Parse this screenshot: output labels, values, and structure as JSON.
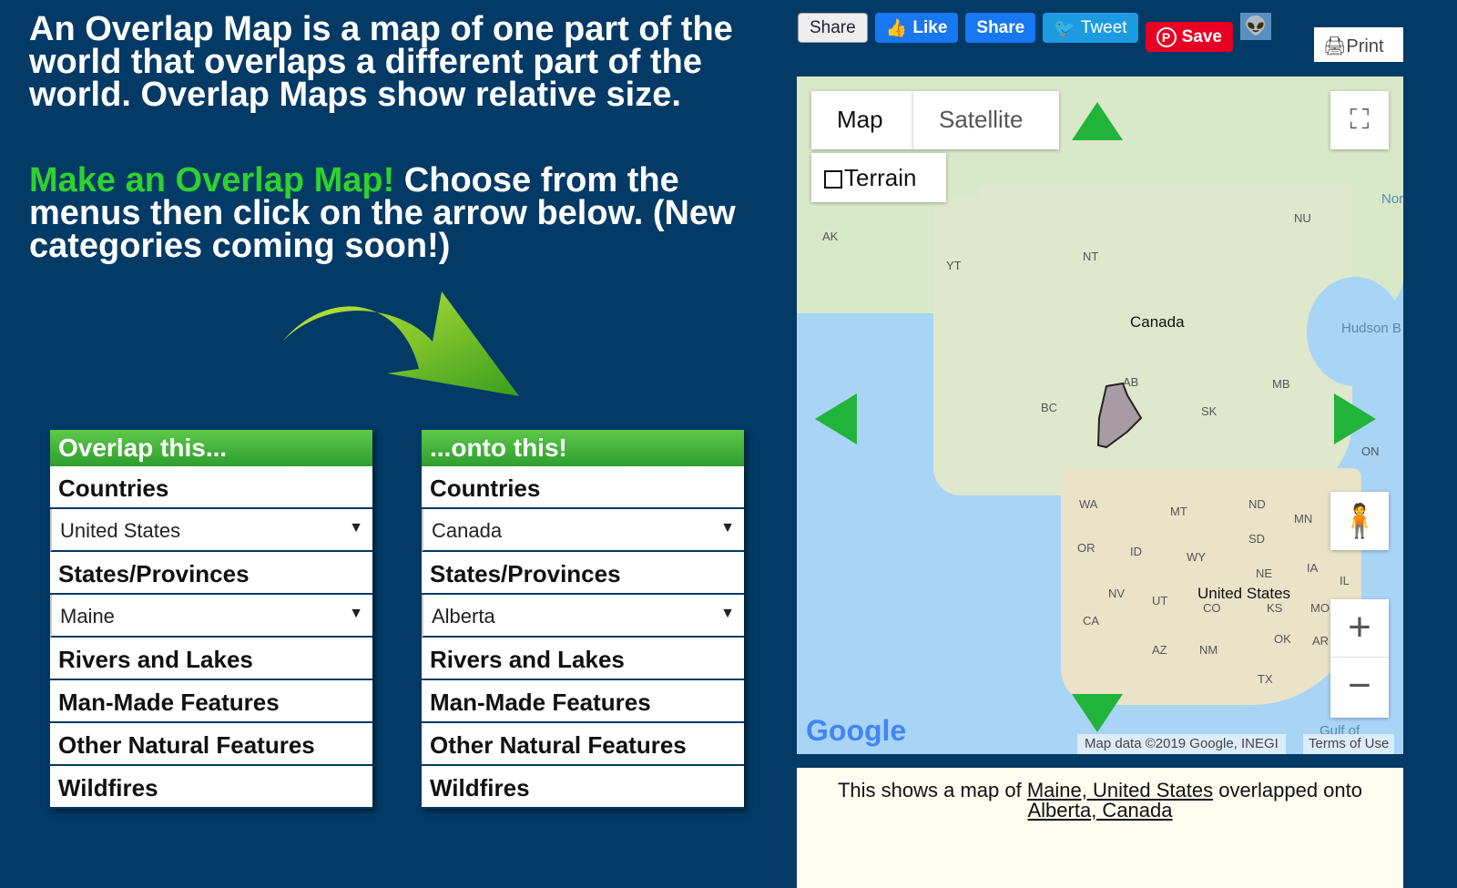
{
  "intro": {
    "line": "An Overlap Map is a map of one part of the world that overlaps a different part of the world. Overlap Maps show relative size.",
    "cta_green": "Make an Overlap Map!",
    "cta_rest": " Choose from the menus then click on the arrow below. (New categories coming soon!)"
  },
  "left_menu": {
    "title": "Overlap this...",
    "items": [
      "Countries",
      "States/Provinces",
      "Rivers and Lakes",
      "Man-Made Features",
      "Other Natural Features",
      "Wildfires"
    ],
    "country_value": "United States",
    "state_value": "Maine"
  },
  "right_menu": {
    "title": "...onto this!",
    "items": [
      "Countries",
      "States/Provinces",
      "Rivers and Lakes",
      "Man-Made Features",
      "Other Natural Features",
      "Wildfires"
    ],
    "country_value": "Canada",
    "state_value": "Alberta"
  },
  "share": {
    "share": "Share",
    "like": "Like",
    "fb_share": "Share",
    "tweet": "Tweet",
    "save": "Save",
    "print": "Print"
  },
  "colors": {
    "fb": "#1877f2",
    "twitter": "#1da1f2",
    "pinterest": "#e60023",
    "background": "#033a66",
    "accent_green": "#2fd12f"
  },
  "map": {
    "map_tab": "Map",
    "satellite_tab": "Satellite",
    "terrain": "Terrain",
    "attribution": "Map data ©2019 Google, INEGI",
    "terms": "Terms of Use",
    "logo": "Google",
    "labels": [
      "AK",
      "YT",
      "NT",
      "NU",
      "Canada",
      "Hudson B",
      "AB",
      "MB",
      "BC",
      "SK",
      "ON",
      "WA",
      "MT",
      "ND",
      "MN",
      "OR",
      "ID",
      "WY",
      "SD",
      "NE",
      "IA",
      "IL",
      "NV",
      "UT",
      "United States",
      "CO",
      "KS",
      "MO",
      "CA",
      "OK",
      "AR",
      "AZ",
      "NM",
      "TX",
      "Gulf of",
      "Nor"
    ]
  },
  "result": {
    "prefix": "This shows a map of ",
    "source": "Maine, United States",
    "middle": " overlapped onto ",
    "target": "Alberta, Canada"
  }
}
